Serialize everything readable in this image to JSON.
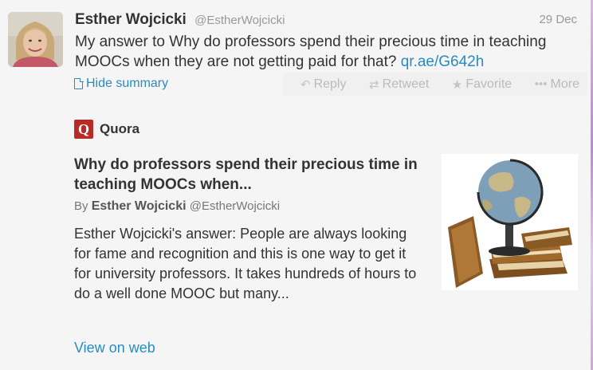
{
  "tweet": {
    "fullname": "Esther Wojcicki",
    "username": "@EstherWojcicki",
    "date": "29 Dec",
    "text": "My answer to Why do professors spend their precious time in teaching MOOCs when they are not getting paid for that?",
    "link": "qr.ae/G642h",
    "hide_summary_label": "Hide summary"
  },
  "actions": {
    "reply": "Reply",
    "retweet": "Retweet",
    "favorite": "Favorite",
    "more": "More"
  },
  "card": {
    "brand": "Quora",
    "brand_logo_letter": "Q",
    "title": "Why do professors spend their precious time in teaching MOOCs when...",
    "by_label": "By",
    "author": "Esther Wojcicki",
    "author_handle": "@EstherWojcicki",
    "body": "Esther Wojcicki's answer: People are always looking for fame and recognition and this is one way to get it for university professors. It takes hundreds of hours to do a well done MOOC but many...",
    "view_link": "View on web"
  },
  "colors": {
    "link": "#2a8bbf",
    "quora_brand": "#b92b27",
    "muted": "#999999"
  },
  "icons": {
    "reply": "reply-arrow-icon",
    "retweet": "retweet-icon",
    "favorite": "star-icon",
    "more": "dots-icon",
    "summary": "document-icon"
  }
}
